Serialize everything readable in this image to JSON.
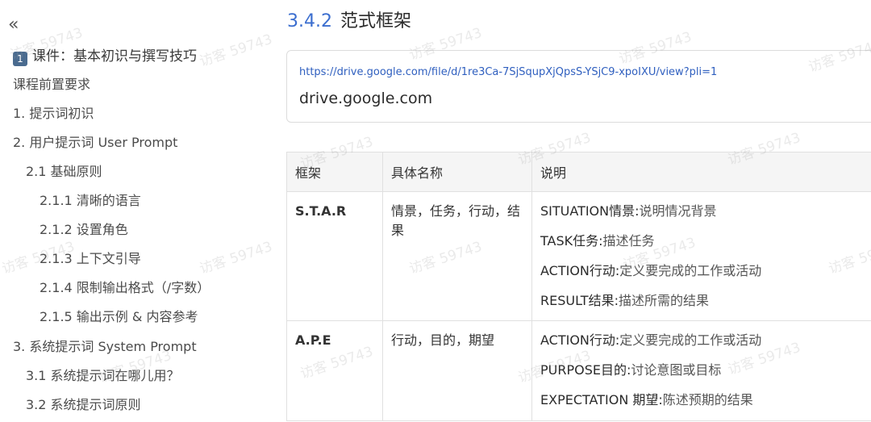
{
  "sidebar": {
    "collapse_icon": "double-chevron-left-icon",
    "items": [
      {
        "label": "课件：基本初识与撰写技巧",
        "badge": "1"
      },
      {
        "label": "课程前置要求"
      },
      {
        "label": "1. 提示词初识"
      },
      {
        "label": "2. 用户提示词 User Prompt"
      },
      {
        "label": "2.1 基础原则"
      },
      {
        "label": "2.1.1 清晰的语言"
      },
      {
        "label": "2.1.2 设置角色"
      },
      {
        "label": "2.1.3 上下文引导"
      },
      {
        "label": "2.1.4 限制输出格式（/字数）"
      },
      {
        "label": "2.1.5 输出示例 & 内容参考"
      },
      {
        "label": "3. 系统提示词 System Prompt"
      },
      {
        "label": "3.1 系统提示词在哪儿用？"
      },
      {
        "label": "3.2 系统提示词原则"
      }
    ]
  },
  "main": {
    "section_number": "3.4.2",
    "section_title": "范式框架",
    "bookmark": {
      "url": "https://drive.google.com/file/d/1re3Ca-7SjSqupXjQpsS-YSjC9-xpoIXU/view?pli=1",
      "domain": "drive.google.com"
    },
    "table": {
      "headers": [
        "框架",
        "具体名称",
        "说明"
      ],
      "rows": [
        {
          "frame": "S.T.A.R",
          "name": "情景，任务，行动，结果",
          "desc": [
            {
              "key": "SITUATION情景:",
              "val": "说明情况背景"
            },
            {
              "key": "TASK任务:",
              "val": "描述任务"
            },
            {
              "key": "ACTION行动:",
              "val": "定义要完成的工作或活动"
            },
            {
              "key": "RESULT结果:",
              "val": "描述所需的结果"
            }
          ]
        },
        {
          "frame": "A.P.E",
          "name": "行动，目的，期望",
          "desc": [
            {
              "key": "ACTION行动:",
              "val": "定义要完成的工作或活动"
            },
            {
              "key": "PURPOSE目的:",
              "val": "讨论意图或目标"
            },
            {
              "key": "EXPECTATION 期望:",
              "val": "陈述预期的结果"
            }
          ]
        }
      ]
    }
  },
  "watermark": "访客 59743"
}
